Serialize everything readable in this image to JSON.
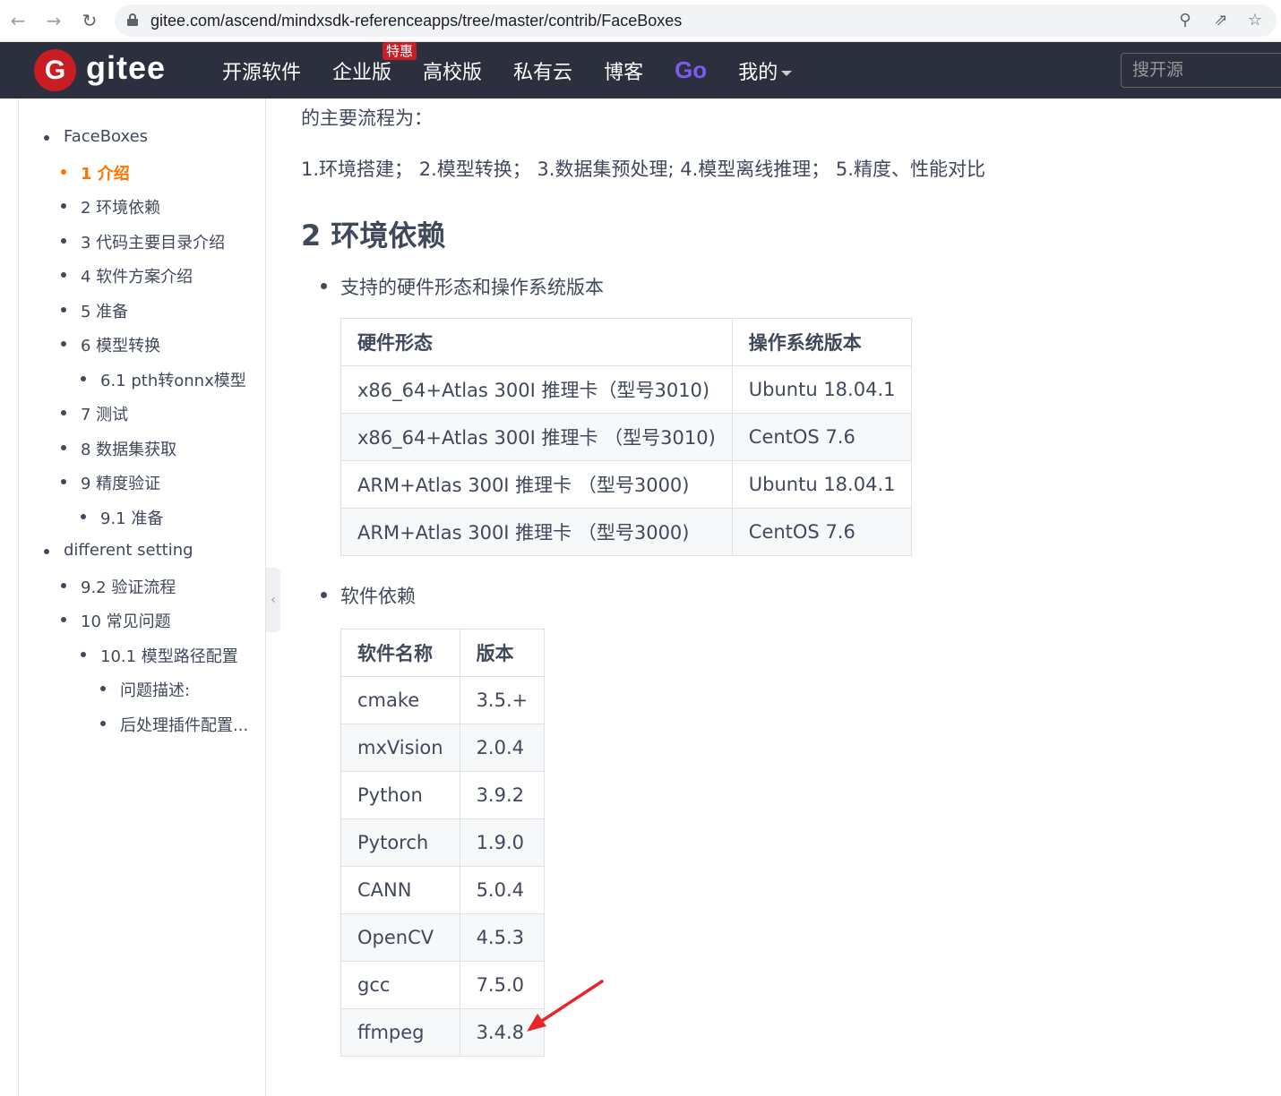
{
  "browser": {
    "url": "gitee.com/ascend/mindxsdk-referenceapps/tree/master/contrib/FaceBoxes"
  },
  "header": {
    "logo_letter": "G",
    "logo_text": "gitee",
    "nav": [
      "开源软件",
      "企业版",
      "高校版",
      "私有云",
      "博客",
      "Go",
      "我的"
    ],
    "badge": "特惠",
    "search_placeholder": "搜开源"
  },
  "sidebar": {
    "items": [
      {
        "label": "FaceBoxes",
        "level": 1
      },
      {
        "label": "1 介绍",
        "level": 2,
        "active": true
      },
      {
        "label": "2 环境依赖",
        "level": 2
      },
      {
        "label": "3  代码主要目录介绍",
        "level": 2
      },
      {
        "label": "4 软件方案介绍",
        "level": 2
      },
      {
        "label": "5 准备",
        "level": 2
      },
      {
        "label": "6 模型转换",
        "level": 2
      },
      {
        "label": "6.1 pth转onnx模型",
        "level": 3
      },
      {
        "label": "7 测试",
        "level": 2
      },
      {
        "label": "8 数据集获取",
        "level": 2
      },
      {
        "label": "9 精度验证",
        "level": 2
      },
      {
        "label": "9.1 准备",
        "level": 3
      },
      {
        "label": "different setting",
        "level": 1
      },
      {
        "label": "9.2 验证流程",
        "level": 2
      },
      {
        "label": "10 常见问题",
        "level": 2
      },
      {
        "label": "10.1 模型路径配置",
        "level": 3
      },
      {
        "label": "问题描述:",
        "level": 4
      },
      {
        "label": "后处理插件配置...",
        "level": 4
      }
    ]
  },
  "content": {
    "intro_tail": "的主要流程为：",
    "steps": "1.环境搭建；  2.模型转换；  3.数据集预处理; 4.模型离线推理；  5.精度、性能对比",
    "heading": "2 环境依赖",
    "bullet_hw": "支持的硬件形态和操作系统版本",
    "bullet_sw": "软件依赖",
    "hw_table": {
      "headers": [
        "硬件形态",
        "操作系统版本"
      ],
      "rows": [
        [
          "x86_64+Atlas 300I 推理卡（型号3010)",
          "Ubuntu 18.04.1"
        ],
        [
          "x86_64+Atlas 300I 推理卡 （型号3010)",
          "CentOS 7.6"
        ],
        [
          "ARM+Atlas 300I 推理卡 （型号3000)",
          "Ubuntu 18.04.1"
        ],
        [
          "ARM+Atlas 300I 推理卡 （型号3000)",
          "CentOS 7.6"
        ]
      ]
    },
    "sw_table": {
      "headers": [
        "软件名称",
        "版本"
      ],
      "rows": [
        [
          "cmake",
          "3.5.+"
        ],
        [
          "mxVision",
          "2.0.4"
        ],
        [
          "Python",
          "3.9.2"
        ],
        [
          "Pytorch",
          "1.9.0"
        ],
        [
          "CANN",
          "5.0.4"
        ],
        [
          "OpenCV",
          "4.5.3"
        ],
        [
          "gcc",
          "7.5.0"
        ],
        [
          "ffmpeg",
          "3.4.8"
        ]
      ]
    }
  }
}
